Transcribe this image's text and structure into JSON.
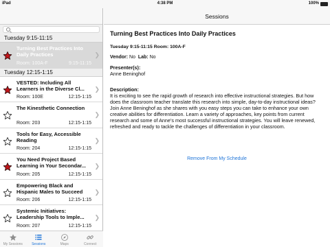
{
  "status_bar": {
    "carrier": "iPad",
    "time": "4:38 PM",
    "battery": "100%"
  },
  "left": {
    "search": {
      "placeholder": ""
    },
    "sections": [
      {
        "header": "Tuesday 9:15-11:15",
        "items": [
          {
            "title": "Turning Best Practices Into Daily Practices",
            "room": "Room: 100A-F",
            "time": "9:15-11:15",
            "starred": true,
            "selected": true
          }
        ]
      },
      {
        "header": "Tuesday 12:15-1:15",
        "items": [
          {
            "title": "VESTED: Including All Learners in the Diverse Cl...",
            "room": "Room: 100E",
            "time": "12:15-1:15",
            "starred": true,
            "selected": false
          },
          {
            "title": "The Kinesthetic Connection",
            "room": "Room: 203",
            "time": "12:15-1:15",
            "starred": false,
            "selected": false
          },
          {
            "title": "Tools for Easy, Accessible Reading",
            "room": "Room: 204",
            "time": "12:15-1:15",
            "starred": false,
            "selected": false
          },
          {
            "title": "You Need Project Based Learning in Your Secondar...",
            "room": "Room: 205",
            "time": "12:15-1:15",
            "starred": true,
            "selected": false
          },
          {
            "title": "Empowering Black and Hispanic Males to Succeed",
            "room": "Room: 206",
            "time": "12:15-1:15",
            "starred": false,
            "selected": false
          },
          {
            "title": "Systemic Initiatives: Leadership Tools to Imple...",
            "room": "Room: 207",
            "time": "12:15-1:15",
            "starred": false,
            "selected": false
          }
        ]
      }
    ],
    "tabs": [
      {
        "label": "My Sessions",
        "icon": "star-icon",
        "active": false
      },
      {
        "label": "Sessions",
        "icon": "list-icon",
        "active": true
      },
      {
        "label": "Maps",
        "icon": "compass-icon",
        "active": false
      },
      {
        "label": "Connect",
        "icon": "link-icon",
        "active": false
      }
    ]
  },
  "right": {
    "nav_title": "Sessions",
    "session_title": "Turning Best Practices Into Daily Practices",
    "time_room": "Tuesday 9:15-11:15 Room: 100A-F",
    "vendor_label": "Vendor:",
    "vendor_value": "No",
    "lab_label": "Lab:",
    "lab_value": "No",
    "presenter_label": "Presenter(s):",
    "presenter": "Anne Beninghof",
    "description_label": "Description:",
    "description": "It is exciting to see the rapid growth of research into effective instructional strategies. But how does the classroom teacher translate this research into simple, day-to-day instructional ideas? Join Anne Beninghof as she shares with you easy steps you can take to enhance your own creative abilities for differentiation. Learn a variety of approaches, key points from current research and some of Anne’s most successful instructional strategies. You will leave renewed, refreshed and ready to tackle the challenges of differentiation in your classroom.",
    "remove_link": "Remove From My Schedule"
  },
  "colors": {
    "accent": "#1e74d8",
    "star_fill": "#c0161b",
    "selected_row": "#d9d9d9"
  }
}
